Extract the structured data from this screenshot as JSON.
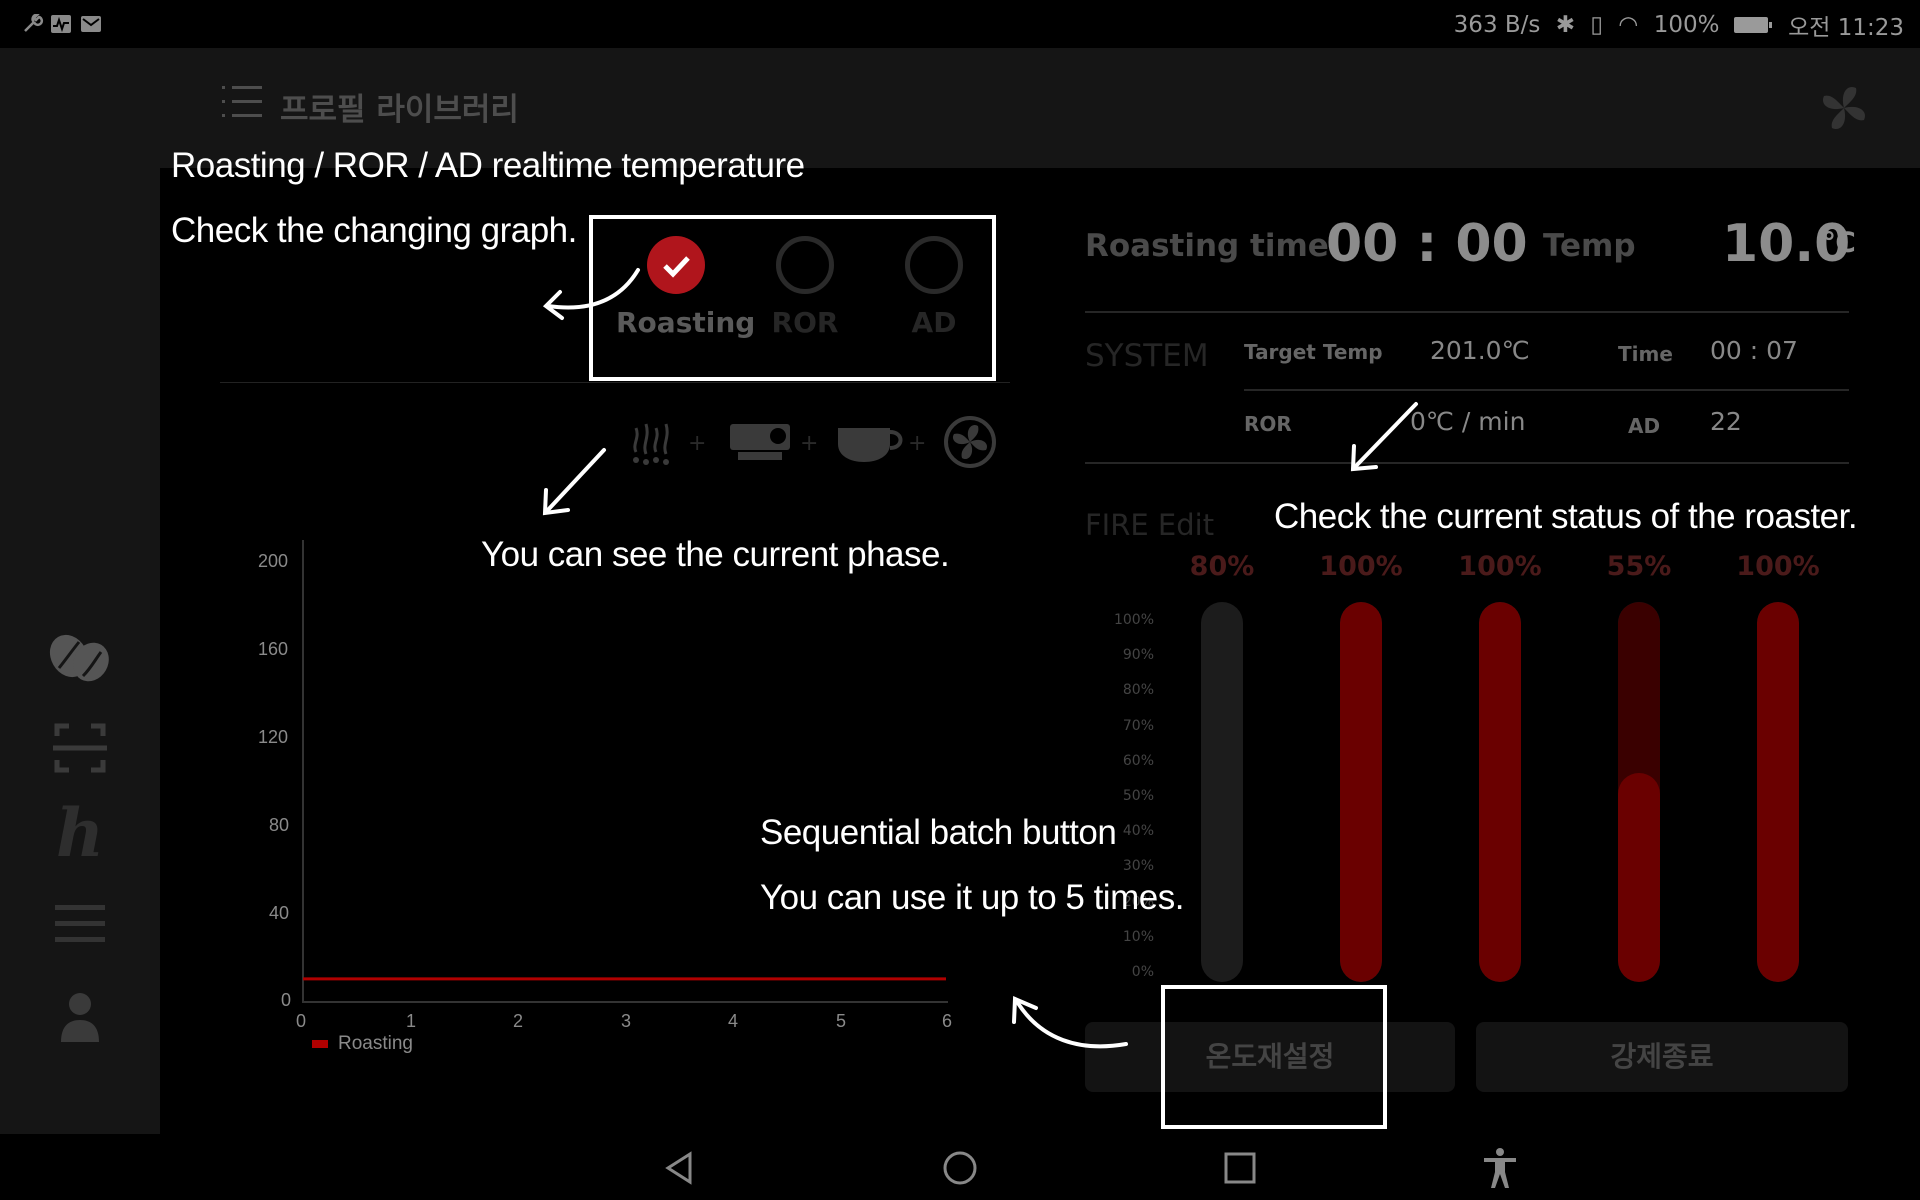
{
  "status_bar": {
    "net_speed": "363 B/s",
    "battery": "100%",
    "time": "오전 11:23",
    "icons": [
      "wrench-icon",
      "activity-icon",
      "mail-icon",
      "bluetooth-icon",
      "vibrate-icon",
      "wifi-icon",
      "battery-icon"
    ]
  },
  "header": {
    "title": "프로필 라이브러리",
    "menu_icon": "menu-icon",
    "logo_icon": "fan-logo-icon"
  },
  "sidebar": {
    "items": [
      {
        "name": "beans-icon"
      },
      {
        "name": "scan-icon"
      },
      {
        "name": "h-logo-icon"
      },
      {
        "name": "list-icon"
      },
      {
        "name": "user-icon"
      }
    ]
  },
  "phases": [
    {
      "label": "Roasting",
      "active": true
    },
    {
      "label": "ROR",
      "active": false
    },
    {
      "label": "AD",
      "active": false
    }
  ],
  "stage_icons": [
    "steam-icon",
    "roaster-icon",
    "cup-icon",
    "fan-icon"
  ],
  "chart_data": {
    "type": "line",
    "x": [
      0,
      1,
      2,
      3,
      4,
      5,
      6
    ],
    "y_ticks": [
      0,
      40,
      80,
      120,
      160,
      200
    ],
    "ylim": [
      0,
      200
    ],
    "xlim": [
      0,
      6
    ],
    "series": [
      {
        "name": "Roasting",
        "color": "#b00000",
        "x": [
          0,
          6
        ],
        "values": [
          10,
          10
        ]
      }
    ],
    "legend": "bottom-left"
  },
  "status": {
    "roasting_time_label": "Roasting time",
    "roasting_time": "00 : 00",
    "temp_label": "Temp",
    "temp_value": "10.0",
    "temp_unit": "℃",
    "system_label": "SYSTEM",
    "target_temp_label": "Target Temp",
    "target_temp": "201.0℃",
    "time_label": "Time",
    "time_value": "00 : 07",
    "ror_label": "ROR",
    "ror_value": "0℃ / min",
    "ad_label": "AD",
    "ad_value": "22"
  },
  "fire": {
    "label": "FIRE Edit",
    "scale": [
      "100%",
      "90%",
      "80%",
      "70%",
      "60%",
      "50%",
      "40%",
      "30%",
      "20%",
      "10%",
      "0%"
    ],
    "bars": [
      {
        "label": "80%",
        "fill": 0
      },
      {
        "label": "100%",
        "fill": 1.0
      },
      {
        "label": "100%",
        "fill": 1.0
      },
      {
        "label": "55%",
        "fill": 0.55
      },
      {
        "label": "100%",
        "fill": 1.0
      }
    ],
    "colors": {
      "fill": "#6a0000",
      "track": "#1c1c1c",
      "dim_fill": "#3a0000"
    }
  },
  "buttons": {
    "reset_temp": "온도재설정",
    "force_stop": "강제종료"
  },
  "annotations": {
    "graph_line1": "Roasting / ROR / AD realtime temperature",
    "graph_line2": "Check the changing graph.",
    "phase": "You can see the current phase.",
    "status": "Check the current status of the roaster.",
    "batch_line1": "Sequential batch button",
    "batch_line2": "You can use it up to 5 times."
  },
  "nav": [
    "back-icon",
    "home-icon",
    "recents-icon",
    "accessibility-icon"
  ]
}
